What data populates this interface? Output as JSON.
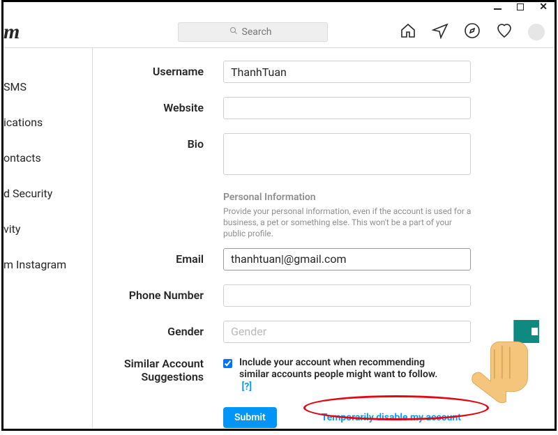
{
  "titlebar": {
    "min": "-",
    "max": "▢",
    "close": "✕"
  },
  "logo": "m",
  "search": {
    "placeholder": "Search"
  },
  "sidebar": {
    "items": [
      {
        "label": "SMS"
      },
      {
        "label": "ications"
      },
      {
        "label": "ontacts"
      },
      {
        "label": "d Security"
      },
      {
        "label": "vity"
      },
      {
        "label": "m Instagram"
      }
    ]
  },
  "form": {
    "username_label": "Username",
    "username_value": "ThanhTuan",
    "website_label": "Website",
    "website_value": "",
    "bio_label": "Bio",
    "bio_value": "",
    "pi_heading": "Personal Information",
    "pi_desc": "Provide your personal information, even if the account is used for a business, a pet or something else. This won't be a part of your public profile.",
    "email_label": "Email",
    "email_value": "thanhtuan|@gmail.com",
    "phone_label": "Phone Number",
    "phone_value": "",
    "gender_label": "Gender",
    "gender_placeholder": "Gender",
    "similar_label_1": "Similar Account",
    "similar_label_2": "Suggestions",
    "similar_desc": "Include your account when recommending similar accounts people might want to follow.",
    "help_q": "[?]",
    "submit": "Submit",
    "disable": "Temporarily disable my account"
  }
}
